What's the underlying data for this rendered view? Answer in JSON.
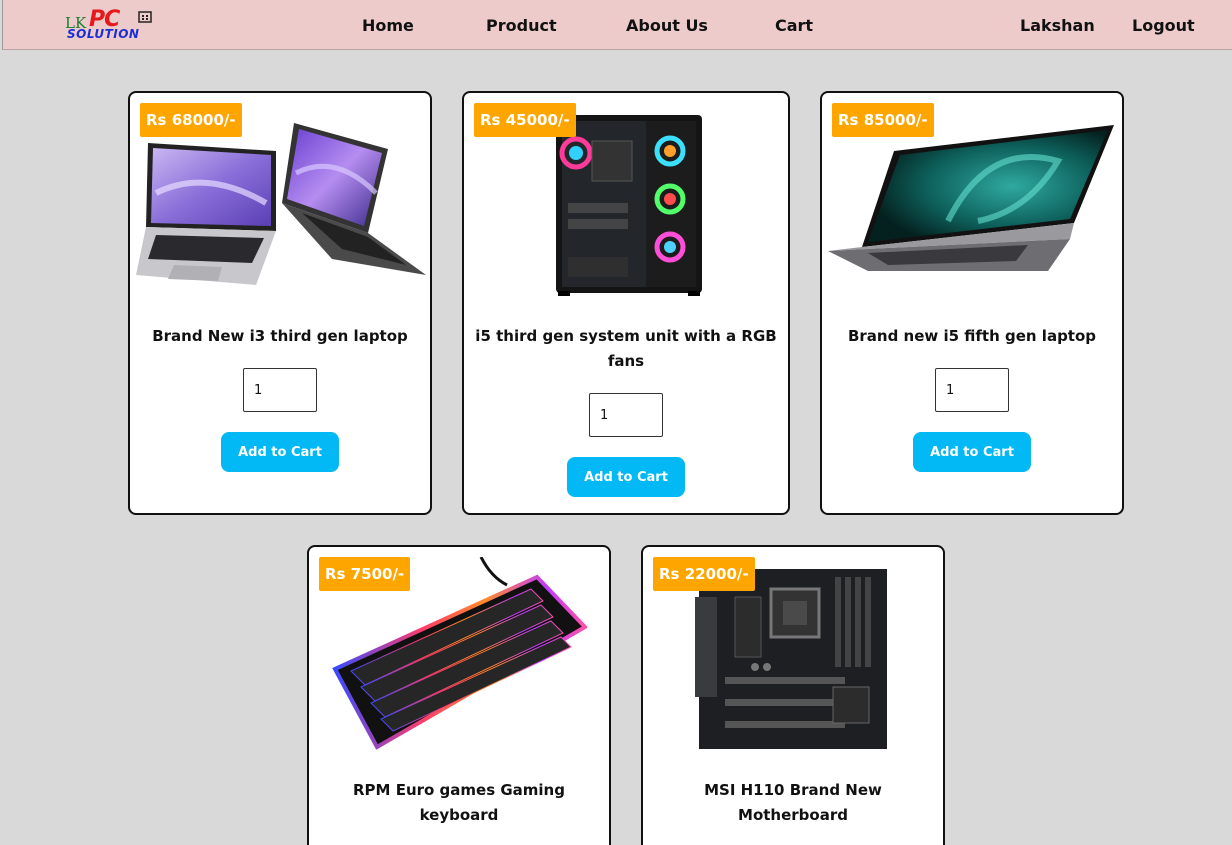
{
  "brand": {
    "logo_lk": "LK",
    "logo_pc": "PC",
    "logo_solution": "SOLUTION"
  },
  "nav": {
    "home": "Home",
    "product": "Product",
    "about": "About Us",
    "cart": "Cart",
    "user": "Lakshan",
    "logout": "Logout"
  },
  "products": [
    {
      "price": "Rs 68000/-",
      "name": "Brand New i3 third gen laptop",
      "qty": "1",
      "button": "Add to Cart",
      "image": "laptop-pair-image"
    },
    {
      "price": "Rs 45000/-",
      "name": "i5 third gen system unit with a RGB fans",
      "qty": "1",
      "button": "Add to Cart",
      "image": "pc-tower-image"
    },
    {
      "price": "Rs 85000/-",
      "name": "Brand new i5 fifth gen laptop",
      "qty": "1",
      "button": "Add to Cart",
      "image": "laptop-image"
    },
    {
      "price": "Rs 7500/-",
      "name": "RPM Euro games Gaming keyboard",
      "image": "rgb-keyboard-image"
    },
    {
      "price": "Rs 22000/-",
      "name": "MSI H110 Brand New Motherboard",
      "image": "motherboard-image"
    }
  ],
  "colors": {
    "navbar": "#eecbcb",
    "background": "#d9d9d9",
    "price_badge": "#ffa500",
    "button": "#03b9f5"
  }
}
